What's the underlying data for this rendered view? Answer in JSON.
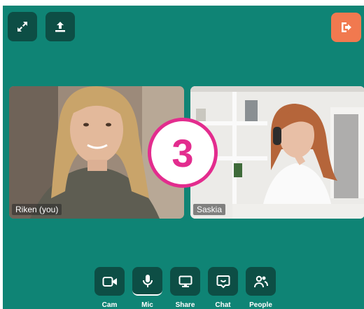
{
  "top_controls": {
    "expand_icon": "expand-icon",
    "upload_icon": "upload-icon",
    "leave_icon": "exit-door-icon",
    "leave_color": "#f1794f"
  },
  "participants": [
    {
      "name": "Riken (you)"
    },
    {
      "name": "Saskia"
    }
  ],
  "overlay_badge": {
    "text": "3",
    "color": "#e32c8e"
  },
  "controls": [
    {
      "label": "Cam",
      "icon": "camera-icon"
    },
    {
      "label": "Mic",
      "icon": "microphone-icon"
    },
    {
      "label": "Share",
      "icon": "screen-share-icon"
    },
    {
      "label": "Chat",
      "icon": "chat-icon"
    },
    {
      "label": "People",
      "icon": "people-icon"
    }
  ],
  "colors": {
    "background": "#0f8475",
    "button": "#0d4e45"
  }
}
